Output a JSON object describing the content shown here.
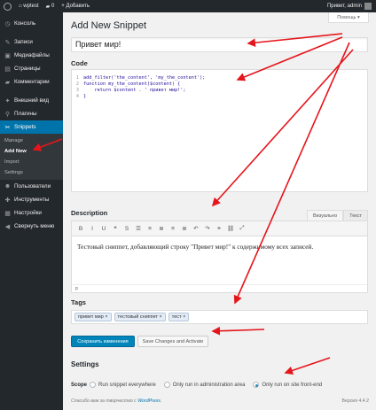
{
  "adminbar": {
    "site_name": "wptest",
    "comments_count": "0",
    "new_label": "+ Добавить",
    "greeting": "Привет, admin"
  },
  "sidebar": {
    "items_top": [
      {
        "label": "Консоль",
        "icon": "dashboard-icon",
        "glyph": "◷"
      }
    ],
    "items_mid": [
      {
        "label": "Записи",
        "icon": "pin-icon",
        "glyph": "✎"
      },
      {
        "label": "Медиафайлы",
        "icon": "media-icon",
        "glyph": "▣"
      },
      {
        "label": "Страницы",
        "icon": "pages-icon",
        "glyph": "▤"
      },
      {
        "label": "Комментарии",
        "icon": "comments-icon",
        "glyph": "▰"
      }
    ],
    "items_mid2": [
      {
        "label": "Внешний вид",
        "icon": "appearance-icon",
        "glyph": "✦"
      },
      {
        "label": "Плагины",
        "icon": "plugins-icon",
        "glyph": "⚲"
      }
    ],
    "current": {
      "label": "Snippets",
      "icon": "snippets-icon",
      "glyph": "✂"
    },
    "submenu": [
      {
        "label": "Manage"
      },
      {
        "label": "Add New"
      },
      {
        "label": "Import"
      },
      {
        "label": "Settings"
      }
    ],
    "items_bottom": [
      {
        "label": "Пользователи",
        "icon": "users-icon",
        "glyph": "☻"
      },
      {
        "label": "Инструменты",
        "icon": "tools-icon",
        "glyph": "✚"
      },
      {
        "label": "Настройки",
        "icon": "settings-icon",
        "glyph": "▦"
      },
      {
        "label": "Свернуть меню",
        "icon": "collapse-icon",
        "glyph": "◀"
      }
    ]
  },
  "main": {
    "help_label": "Помощь ▾",
    "page_title": "Add New Snippet",
    "title_value": "Привет мир!",
    "code_label": "Code",
    "code_lines": [
      "add_filter('the_content', 'my_the_content');",
      "function my_the_content($content) {",
      "    return $content . ' привет мир!';",
      "}"
    ],
    "description_label": "Description",
    "desc_tabs": [
      "Визуально",
      "Текст"
    ],
    "toolbar_icons": [
      {
        "name": "bold-icon",
        "glyph": "B"
      },
      {
        "name": "italic-icon",
        "glyph": "I"
      },
      {
        "name": "underline-icon",
        "glyph": "U"
      },
      {
        "name": "quote-icon",
        "glyph": "❝"
      },
      {
        "name": "strikethrough-icon",
        "glyph": "S"
      },
      {
        "name": "bullet-list-icon",
        "glyph": "☰"
      },
      {
        "name": "numbered-list-icon",
        "glyph": "≡"
      },
      {
        "name": "align-left-icon",
        "glyph": "≣"
      },
      {
        "name": "align-center-icon",
        "glyph": "≡"
      },
      {
        "name": "align-right-icon",
        "glyph": "≣"
      },
      {
        "name": "undo-icon",
        "glyph": "↶"
      },
      {
        "name": "redo-icon",
        "glyph": "↷"
      },
      {
        "name": "link-icon",
        "glyph": "⚭"
      },
      {
        "name": "unlink-icon",
        "glyph": "⛓"
      },
      {
        "name": "fullscreen-icon",
        "glyph": "⤢"
      }
    ],
    "description_text": "Тестовый сниппет, добавляющий строку \"Привет мир!\" к содержимому всех записей.",
    "editor_path": "p",
    "tags_label": "Tags",
    "tags": [
      "привет мир ×",
      "тестовый сниппет ×",
      "тест ×"
    ],
    "save_button": "Сохранить изменения",
    "save_activate_button": "Save Changes and Activate",
    "settings_label": "Settings",
    "scope_label": "Scope",
    "scope_options": [
      {
        "label": "Run snippet everywhere",
        "checked": false
      },
      {
        "label": "Only run in administration area",
        "checked": false
      },
      {
        "label": "Only run on site front-end",
        "checked": true
      }
    ],
    "footer_text": "Спасибо вам за творчество с ",
    "footer_link": "WordPress",
    "footer_dot": ".",
    "version": "Версия 4.4.2"
  },
  "colors": {
    "admin_dark": "#23282d",
    "accent_blue": "#0073aa",
    "arrow_red": "#e5151b"
  }
}
